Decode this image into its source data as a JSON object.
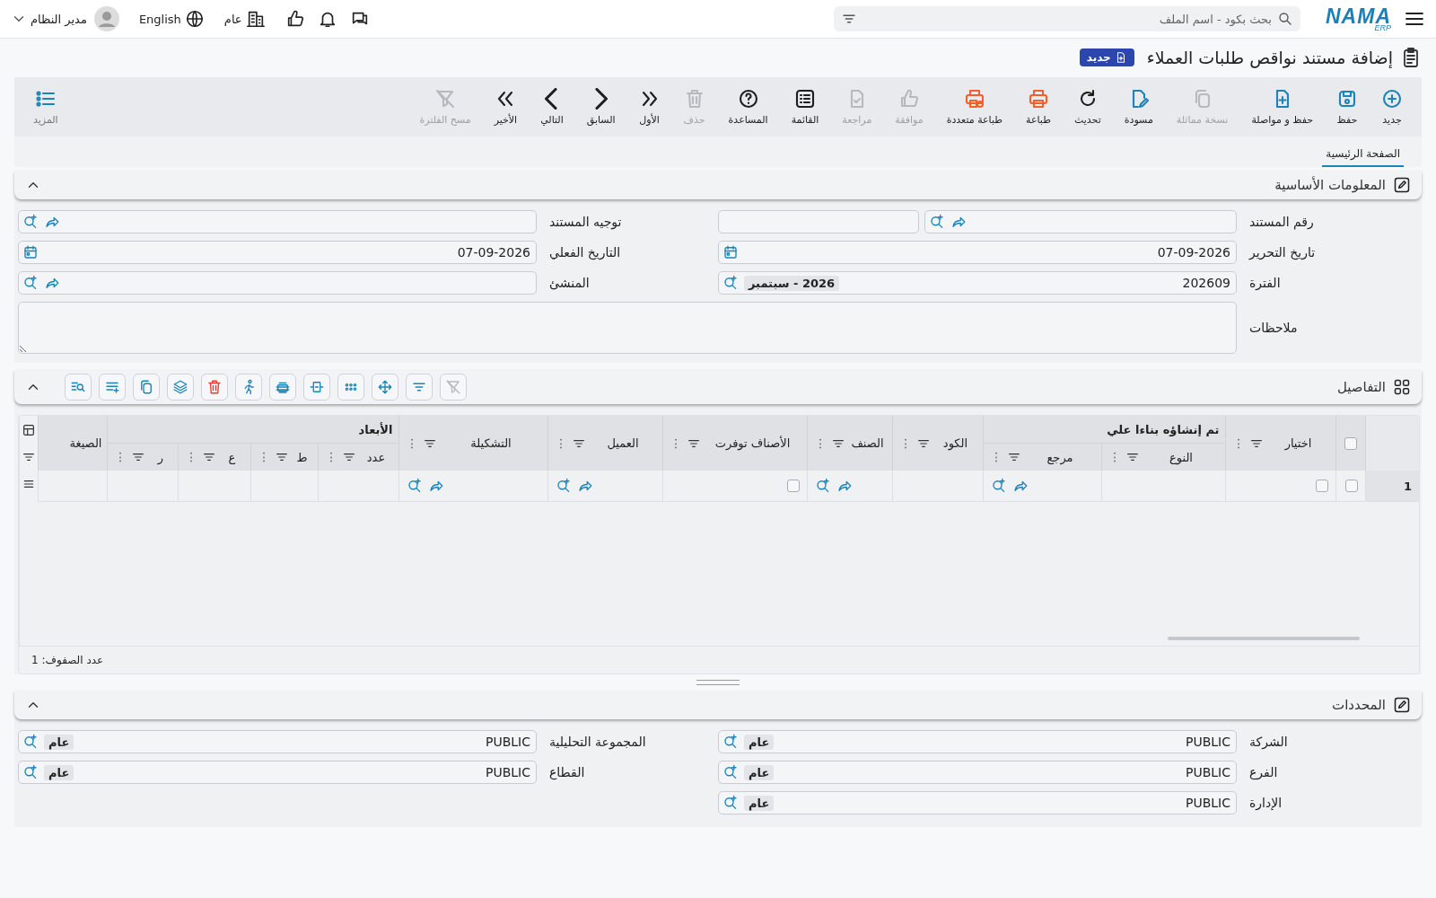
{
  "topbar": {
    "logo": "NAMA",
    "logo_sub": "ERP",
    "search": {
      "placeholder": "بحث بكود - اسم الملف"
    },
    "branch": "عام",
    "language": "English",
    "user": "مدير النظام"
  },
  "page": {
    "title": "إضافة مستند نواقص طلبات العملاء",
    "badge": "جديد"
  },
  "toolbar": [
    {
      "label": "جديد",
      "kind": "plus",
      "enabled": true
    },
    {
      "label": "حفظ",
      "kind": "save",
      "enabled": true
    },
    {
      "label": "حفظ و مواصلة",
      "kind": "fileplus",
      "enabled": true
    },
    {
      "label": "نسخة مماثلة",
      "kind": "copy",
      "enabled": false
    },
    {
      "label": "مسودة",
      "kind": "edit",
      "enabled": true
    },
    {
      "label": "تحديث",
      "kind": "refresh",
      "enabled": true
    },
    {
      "label": "طباعة",
      "kind": "print",
      "enabled": true
    },
    {
      "label": "طباعة متعددة",
      "kind": "printmulti",
      "enabled": true
    },
    {
      "label": "موافقة",
      "kind": "thumb",
      "enabled": false
    },
    {
      "label": "مراجعة",
      "kind": "filecheck",
      "enabled": false
    },
    {
      "label": "القائمة",
      "kind": "list",
      "enabled": true
    },
    {
      "label": "المساعدة",
      "kind": "help",
      "enabled": true
    },
    {
      "label": "حذف",
      "kind": "trash",
      "enabled": false
    },
    {
      "label": "الأول",
      "kind": "first",
      "enabled": true
    },
    {
      "label": "السابق",
      "kind": "prev",
      "enabled": true
    },
    {
      "label": "التالي",
      "kind": "next",
      "enabled": true
    },
    {
      "label": "الأخير",
      "kind": "last",
      "enabled": true
    },
    {
      "label": "مسح الفلترة",
      "kind": "filteroff",
      "enabled": false
    }
  ],
  "more": {
    "label": "المزيد"
  },
  "tabs": [
    {
      "label": "الصفحة الرئيسية",
      "selected": true
    }
  ],
  "basic_info": {
    "title": "المعلومات الأساسية",
    "expanded": true,
    "rows": [
      [
        {
          "label": "رقم المستند",
          "kind": "split"
        },
        {
          "label": "توجيه المستند",
          "kind": "lookup"
        }
      ],
      [
        {
          "label": "تاريخ التحرير",
          "kind": "date",
          "value": "07-09-2026"
        },
        {
          "label": "التاريخ الفعلي",
          "kind": "date",
          "value": "07-09-2026"
        }
      ],
      [
        {
          "label": "الفترة",
          "kind": "period",
          "value": "202609",
          "tag": "2026 - سبتمبر"
        },
        {
          "label": "المنشئ",
          "kind": "lookup"
        }
      ]
    ],
    "notes": {
      "label": "ملاحظات"
    }
  },
  "details": {
    "title": "التفاصيل",
    "expanded": true,
    "tools": [
      {
        "kind": "filteroff",
        "enabled": false
      },
      {
        "kind": "filter",
        "enabled": true
      },
      {
        "kind": "move",
        "enabled": true
      },
      {
        "kind": "dots",
        "enabled": true
      },
      {
        "kind": "fit",
        "enabled": true
      },
      {
        "kind": "rowins",
        "enabled": true
      },
      {
        "kind": "run",
        "enabled": true
      },
      {
        "kind": "trash",
        "enabled": true
      },
      {
        "kind": "layers",
        "enabled": true
      },
      {
        "kind": "copy",
        "enabled": true
      },
      {
        "kind": "listadd",
        "enabled": true
      },
      {
        "kind": "findlist",
        "enabled": true
      }
    ],
    "grid": {
      "columns": [
        {
          "kind": "rownum"
        },
        {
          "kind": "select_all",
          "checked": false
        },
        {
          "kind": "col",
          "label": "اختيار"
        },
        {
          "kind": "group",
          "label": "تم إنشاؤه بناءا علي",
          "children": [
            {
              "label": "النوع"
            },
            {
              "label": "مرجع"
            }
          ]
        },
        {
          "kind": "col",
          "label": "الكود"
        },
        {
          "kind": "col",
          "label": "الصنف"
        },
        {
          "kind": "col",
          "label": "الأصناف توفرت"
        },
        {
          "kind": "col",
          "label": "العميل"
        },
        {
          "kind": "col",
          "label": "التشكيلة"
        },
        {
          "kind": "group",
          "label": "الأبعاد",
          "children": [
            {
              "label": "عدد"
            },
            {
              "label": "ط"
            },
            {
              "label": "ع"
            },
            {
              "label": "ر"
            }
          ]
        },
        {
          "kind": "plain",
          "label": "الصيغة"
        }
      ],
      "rows": [
        {
          "number": "1",
          "cells": [
            {
              "kind": "checkbox",
              "checked": false
            },
            {
              "kind": "checkbox",
              "checked": false
            },
            {
              "kind": "empty"
            },
            {
              "kind": "lookup"
            },
            {
              "kind": "empty"
            },
            {
              "kind": "lookup"
            },
            {
              "kind": "checkbox",
              "checked": false
            },
            {
              "kind": "lookup"
            },
            {
              "kind": "lookup"
            },
            {
              "kind": "empty"
            },
            {
              "kind": "empty"
            },
            {
              "kind": "empty"
            },
            {
              "kind": "empty"
            },
            {
              "kind": "empty"
            }
          ]
        }
      ],
      "row_count": "عدد الصفوف: 1"
    }
  },
  "selectors": {
    "title": "المحددات",
    "expanded": true,
    "rows": [
      [
        {
          "label": "الشركة",
          "kind": "dimension",
          "value": "PUBLIC",
          "tag": "عام"
        },
        {
          "label": "المجموعة التحليلية",
          "kind": "dimension",
          "value": "PUBLIC",
          "tag": "عام"
        }
      ],
      [
        {
          "label": "الفرع",
          "kind": "dimension",
          "value": "PUBLIC",
          "tag": "عام"
        },
        {
          "label": "القطاع",
          "kind": "dimension",
          "value": "PUBLIC",
          "tag": "عام"
        }
      ],
      [
        {
          "label": "الإدارة",
          "kind": "dimension",
          "value": "PUBLIC",
          "tag": "عام"
        }
      ]
    ]
  }
}
